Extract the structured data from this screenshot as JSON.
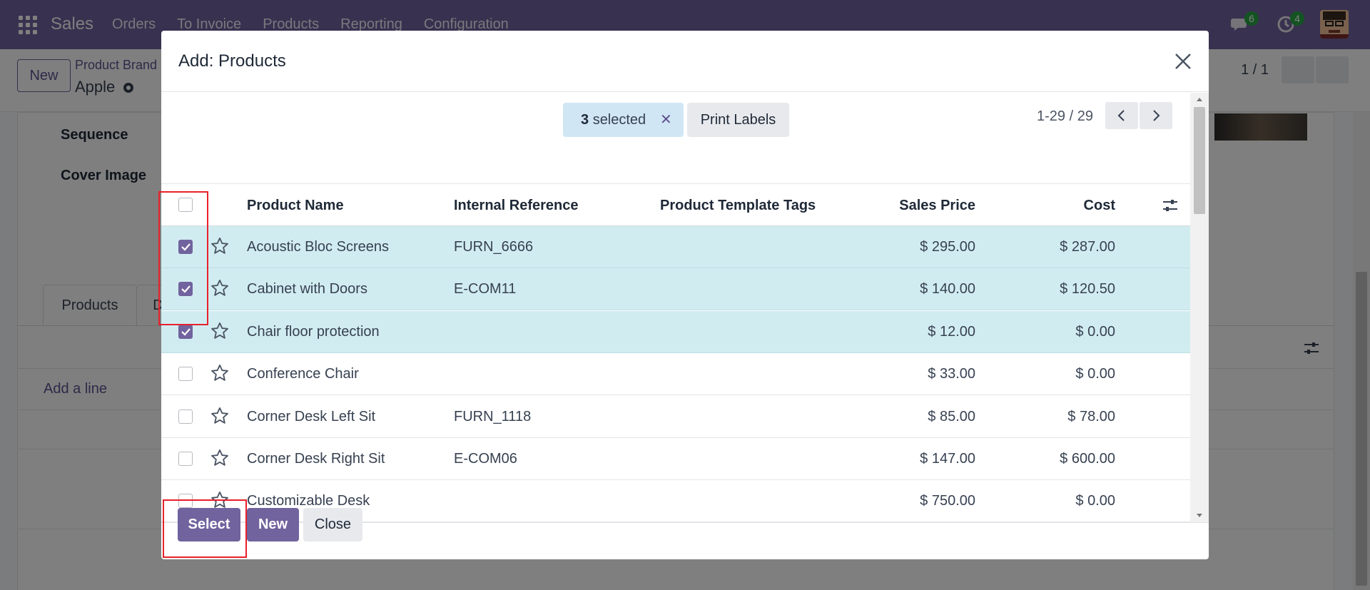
{
  "navbar": {
    "brand": "Sales",
    "menu": [
      "Orders",
      "To Invoice",
      "Products",
      "Reporting",
      "Configuration"
    ],
    "messages_count": "6",
    "activities_count": "4"
  },
  "background": {
    "new_label": "New",
    "breadcrumb_parent": "Product Brand",
    "breadcrumb_current": "Apple",
    "pager": "1 / 1",
    "field_sequence": "Sequence",
    "field_cover_image": "Cover Image",
    "tab_products": "Products",
    "tab_other": "D",
    "add_line": "Add a line"
  },
  "modal": {
    "title": "Add: Products",
    "selected_count": "3",
    "selected_label": "selected",
    "print_labels": "Print Labels",
    "pager": "1-29 / 29",
    "columns": {
      "name": "Product Name",
      "ref": "Internal Reference",
      "tags": "Product Template Tags",
      "price": "Sales Price",
      "cost": "Cost"
    },
    "rows": [
      {
        "name": "Acoustic Bloc Screens",
        "ref": "FURN_6666",
        "price": "$ 295.00",
        "cost": "$ 287.00",
        "selected": true
      },
      {
        "name": "Cabinet with Doors",
        "ref": "E-COM11",
        "price": "$ 140.00",
        "cost": "$ 120.50",
        "selected": true
      },
      {
        "name": "Chair floor protection",
        "ref": "",
        "price": "$ 12.00",
        "cost": "$ 0.00",
        "selected": true
      },
      {
        "name": "Conference Chair",
        "ref": "",
        "price": "$ 33.00",
        "cost": "$ 0.00",
        "selected": false
      },
      {
        "name": "Corner Desk Left Sit",
        "ref": "FURN_1118",
        "price": "$ 85.00",
        "cost": "$ 78.00",
        "selected": false
      },
      {
        "name": "Corner Desk Right Sit",
        "ref": "E-COM06",
        "price": "$ 147.00",
        "cost": "$ 600.00",
        "selected": false
      },
      {
        "name": "Customizable Desk",
        "ref": "",
        "price": "$ 750.00",
        "cost": "$ 0.00",
        "selected": false
      }
    ],
    "footer": {
      "select": "Select",
      "new": "New",
      "close": "Close"
    }
  },
  "colors": {
    "primary": "#71639e",
    "selected_row": "#d1ecf1",
    "highlight": "#e8202a"
  }
}
